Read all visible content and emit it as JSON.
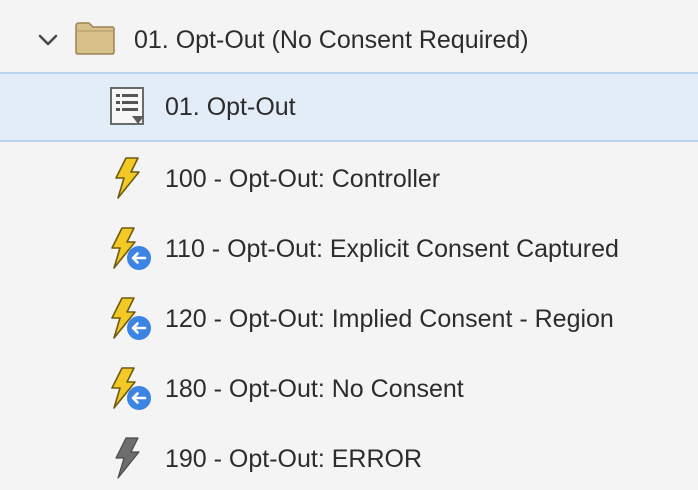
{
  "colors": {
    "background": "#f4f4f4",
    "selected_background": "#e3edf8",
    "selected_border": "#bcd3ef",
    "bolt_yellow": "#f2c925",
    "bolt_gray": "#6e6e6e",
    "badge_blue": "#3b84e4",
    "folder_tan": "#d8c08a"
  },
  "folder": {
    "label": "01. Opt-Out (No Consent Required)",
    "expanded": true,
    "icon": "folder-icon",
    "toggle_icon": "chevron-down-icon"
  },
  "items": [
    {
      "label": "01. Opt-Out",
      "icon": "data-element-list-icon",
      "selected": true
    },
    {
      "label": "100 - Opt-Out: Controller",
      "icon": "lightning-bolt-icon",
      "selected": false
    },
    {
      "label": "110 - Opt-Out: Explicit Consent Captured",
      "icon": "lightning-bolt-with-arrow-icon",
      "selected": false
    },
    {
      "label": "120 - Opt-Out: Implied Consent - Region",
      "icon": "lightning-bolt-with-arrow-icon",
      "selected": false
    },
    {
      "label": "180 - Opt-Out: No Consent",
      "icon": "lightning-bolt-with-arrow-icon",
      "selected": false
    },
    {
      "label": "190 - Opt-Out: ERROR",
      "icon": "gray-lightning-bolt-icon",
      "selected": false
    }
  ]
}
